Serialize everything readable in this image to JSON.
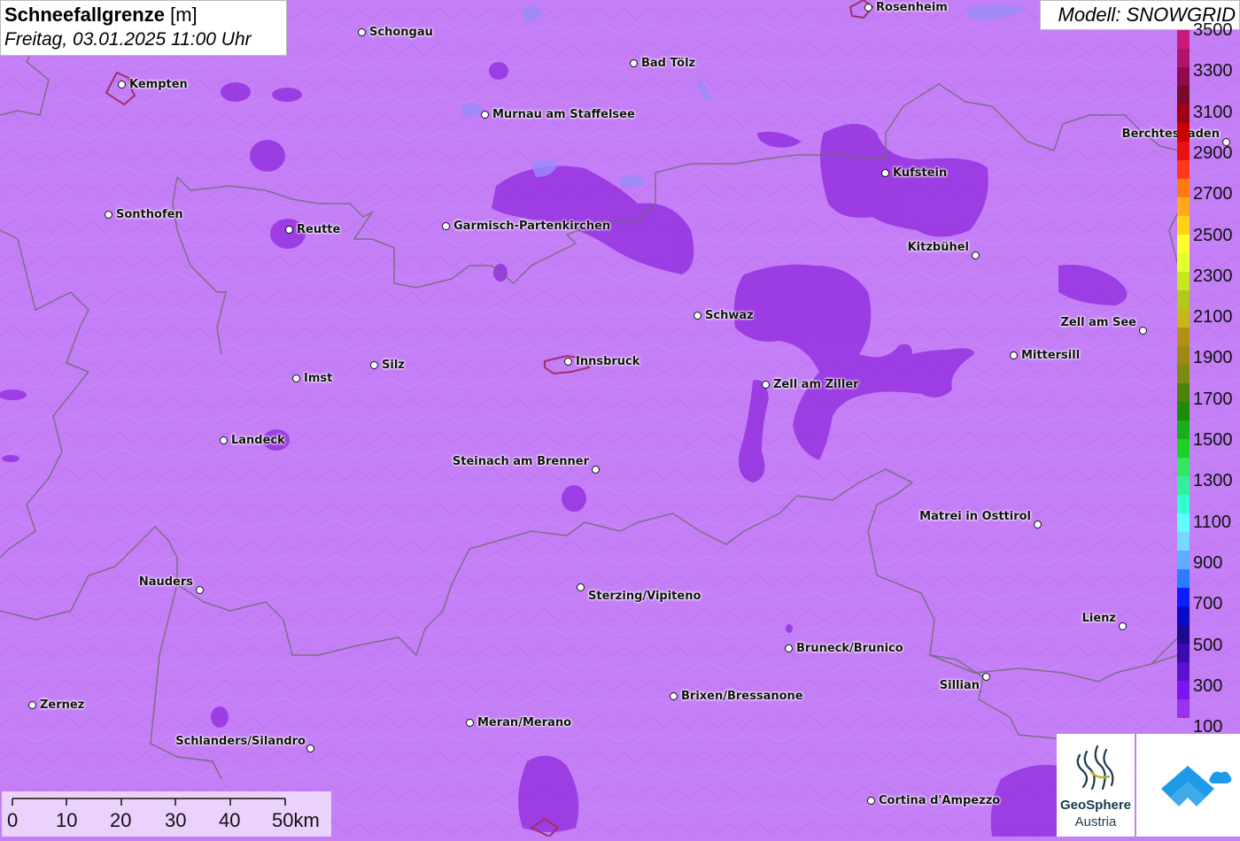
{
  "title": {
    "main": "Schneefallgrenze",
    "unit": "[m]",
    "datetime": "Freitag, 03.01.2025 11:00 Uhr"
  },
  "model": "Modell: SNOWGRID",
  "cities": [
    {
      "name": "Rosenheim"
    },
    {
      "name": "Schongau"
    },
    {
      "name": "Kempten"
    },
    {
      "name": "Bad Tölz"
    },
    {
      "name": "Murnau am Staffelsee"
    },
    {
      "name": "Berchtesgaden"
    },
    {
      "name": "Kufstein"
    },
    {
      "name": "Sonthofen"
    },
    {
      "name": "Reutte"
    },
    {
      "name": "Garmisch-Partenkirchen"
    },
    {
      "name": "Kitzbühel"
    },
    {
      "name": "Schwaz"
    },
    {
      "name": "Zell am See"
    },
    {
      "name": "Mittersill"
    },
    {
      "name": "Innsbruck"
    },
    {
      "name": "Silz"
    },
    {
      "name": "Imst"
    },
    {
      "name": "Zell am Ziller"
    },
    {
      "name": "Landeck"
    },
    {
      "name": "Steinach am Brenner"
    },
    {
      "name": "Matrei in Osttirol"
    },
    {
      "name": "Nauders"
    },
    {
      "name": "Sterzing/Vipiteno"
    },
    {
      "name": "Lienz"
    },
    {
      "name": "Bruneck/Brunico"
    },
    {
      "name": "Sillian"
    },
    {
      "name": "Brixen/Bressanone"
    },
    {
      "name": "Zernez"
    },
    {
      "name": "Meran/Merano"
    },
    {
      "name": "Schlanders/Silandro"
    },
    {
      "name": "Cortina d'Ampezzo"
    }
  ],
  "legend": {
    "labels": [
      "3500",
      "3300",
      "3100",
      "2900",
      "2700",
      "2500",
      "2300",
      "2100",
      "1900",
      "1700",
      "1500",
      "1300",
      "1100",
      "900",
      "700",
      "500",
      "300",
      "100"
    ],
    "colors": [
      "#c81a78",
      "#b0136a",
      "#8f0a4e",
      "#7a0a2c",
      "#9e0016",
      "#c80000",
      "#e81010",
      "#ff3a1a",
      "#ff7b10",
      "#ffa81a",
      "#ffd21a",
      "#ffff30",
      "#e2ff30",
      "#c4e81a",
      "#b2c81a",
      "#c8b61a",
      "#b49010",
      "#9e8a10",
      "#7e8a0a",
      "#4e820a",
      "#1e8a0a",
      "#18b018",
      "#20d020",
      "#30e860",
      "#30f0a0",
      "#30ffd0",
      "#60ffff",
      "#78d8ff",
      "#60aaff",
      "#2c7cff",
      "#0a1eff",
      "#0a0ac8",
      "#1c0a8c",
      "#3c0ab0",
      "#5c10d0",
      "#7a14f0",
      "#9a30f0",
      "#c47ff7"
    ]
  },
  "scalebar": {
    "labels": [
      "0",
      "10",
      "20",
      "30",
      "40",
      "50km"
    ]
  },
  "logos": {
    "geosphere_line1": "GeoSphere",
    "geosphere_line2": "Austria"
  },
  "colors": {
    "background": "#c47ff7",
    "snowline_low": "#9632e0",
    "border": "#666666",
    "city_outline": "#a0306a"
  }
}
